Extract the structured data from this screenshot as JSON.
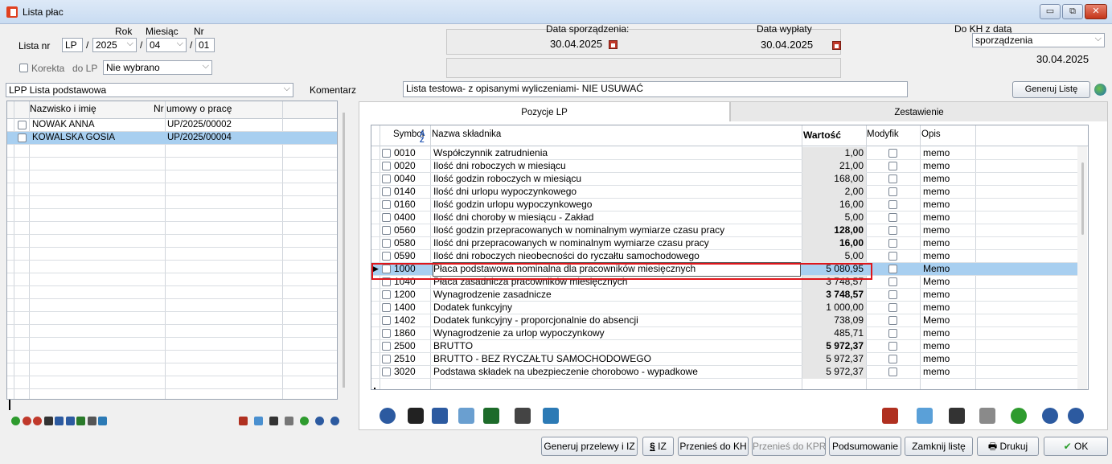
{
  "window": {
    "title": "Lista płac",
    "buttons": [
      "▭",
      "⧉",
      "✕"
    ]
  },
  "header": {
    "lista_nr_label": "Lista nr",
    "rok_label": "Rok",
    "miesiac_label": "Miesiąc",
    "nr_label": "Nr",
    "lista_prefix": "LP",
    "sep": "/",
    "rok_value": "2025",
    "miesiac_value": "04",
    "nr_value": "01",
    "korekta_label": "Korekta",
    "do_lp_label": "do LP",
    "do_lp_value": "Nie wybrano",
    "data_sporzadzenia_label": "Data sporządzenia:",
    "data_sporzadzenia_value": "30.04.2025",
    "data_wyplaty_label": "Data wypłaty",
    "data_wyplaty_value": "30.04.2025",
    "do_kh_label": "Do KH z datą",
    "do_kh_select": "sporządzenia",
    "do_kh_value": "30.04.2025"
  },
  "list_type": {
    "value": "LPP Lista podstawowa",
    "komentarz_label": "Komentarz",
    "komentarz_value": "Lista testowa- z opisanymi wyliczeniami- NIE USUWAĆ",
    "generuj_button": "Generuj Listę"
  },
  "employees": {
    "headers": [
      "Nazwisko i imię",
      "Nr umowy o pracę"
    ],
    "rows": [
      {
        "name": "NOWAK ANNA",
        "nr": "UP/2025/00002",
        "selected": false
      },
      {
        "name": "KOWALSKA GOSIA",
        "nr": "UP/2025/00004",
        "selected": true
      }
    ]
  },
  "tabs": [
    {
      "label": "Pozycje LP",
      "active": true
    },
    {
      "label": "Zestawienie",
      "active": false
    }
  ],
  "positions": {
    "headers": {
      "symbol": "Symbol",
      "nazwa": "Nazwa składnika",
      "wartosc": "Wartość",
      "modyfik": "Modyfik",
      "opis": "Opis"
    },
    "rows": [
      {
        "sym": "0010",
        "name": "Współczynnik zatrudnienia",
        "val": "1,00",
        "bold": false,
        "opis": "memo",
        "sel": false
      },
      {
        "sym": "0020",
        "name": "Ilość dni roboczych w miesiącu",
        "val": "21,00",
        "bold": false,
        "opis": "memo",
        "sel": false
      },
      {
        "sym": "0040",
        "name": "Ilość godzin roboczych w miesiącu",
        "val": "168,00",
        "bold": false,
        "opis": "memo",
        "sel": false
      },
      {
        "sym": "0140",
        "name": "Ilość dni urlopu wypoczynkowego",
        "val": "2,00",
        "bold": false,
        "opis": "memo",
        "sel": false
      },
      {
        "sym": "0160",
        "name": "Ilość godzin urlopu wypoczynkowego",
        "val": "16,00",
        "bold": false,
        "opis": "memo",
        "sel": false
      },
      {
        "sym": "0400",
        "name": "Ilość dni choroby w miesiącu - Zakład",
        "val": "5,00",
        "bold": false,
        "opis": "memo",
        "sel": false
      },
      {
        "sym": "0560",
        "name": "Ilość godzin przepracowanych w nominalnym wymiarze czasu pracy",
        "val": "128,00",
        "bold": true,
        "opis": "memo",
        "sel": false
      },
      {
        "sym": "0580",
        "name": "Ilość dni przepracowanych w nominalnym wymiarze czasu pracy",
        "val": "16,00",
        "bold": true,
        "opis": "memo",
        "sel": false
      },
      {
        "sym": "0590",
        "name": "Ilość dni roboczych nieobecności do ryczałtu samochodowego",
        "val": "5,00",
        "bold": false,
        "opis": "memo",
        "sel": false
      },
      {
        "sym": "1000",
        "name": "Płaca podstawowa nominalna dla pracowników miesięcznych",
        "val": "5 080,95",
        "bold": false,
        "opis": "Memo",
        "sel": true
      },
      {
        "sym": "1040",
        "name": "Płaca zasadnicza pracowników miesięcznych",
        "val": "3 748,57",
        "bold": false,
        "opis": "Memo",
        "sel": false
      },
      {
        "sym": "1200",
        "name": "Wynagrodzenie zasadnicze",
        "val": "3 748,57",
        "bold": true,
        "opis": "memo",
        "sel": false
      },
      {
        "sym": "1400",
        "name": "Dodatek funkcyjny",
        "val": "1 000,00",
        "bold": false,
        "opis": "memo",
        "sel": false
      },
      {
        "sym": "1402",
        "name": "Dodatek funkcyjny - proporcjonalnie do absencji",
        "val": "738,09",
        "bold": false,
        "opis": "Memo",
        "sel": false
      },
      {
        "sym": "1860",
        "name": "Wynagrodzenie za urlop wypoczynkowy",
        "val": "485,71",
        "bold": false,
        "opis": "memo",
        "sel": false
      },
      {
        "sym": "2500",
        "name": "BRUTTO",
        "val": "5 972,37",
        "bold": true,
        "opis": "memo",
        "sel": false
      },
      {
        "sym": "2510",
        "name": "BRUTTO - BEZ RYCZAŁTU SAMOCHODOWEGO",
        "val": "5 972,37",
        "bold": false,
        "opis": "memo",
        "sel": false
      },
      {
        "sym": "3020",
        "name": "Podstawa składek na ubezpieczenie chorobowo - wypadkowe",
        "val": "5 972,37",
        "bold": false,
        "opis": "memo",
        "sel": false
      }
    ]
  },
  "bottom_buttons": {
    "generuj_przelewy": "Generuj przelewy i IZ",
    "iz": "IZ",
    "przenies_kh": "Przenieś do KH",
    "przenies_kpr": "Przenieś do KPR",
    "podsumowanie": "Podsumowanie",
    "zamknij": "Zamknij listę",
    "drukuj": "Drukuj",
    "ok": "OK"
  },
  "colors": {
    "selection": "#a8cff0",
    "highlight_frame": "#e0161b"
  }
}
